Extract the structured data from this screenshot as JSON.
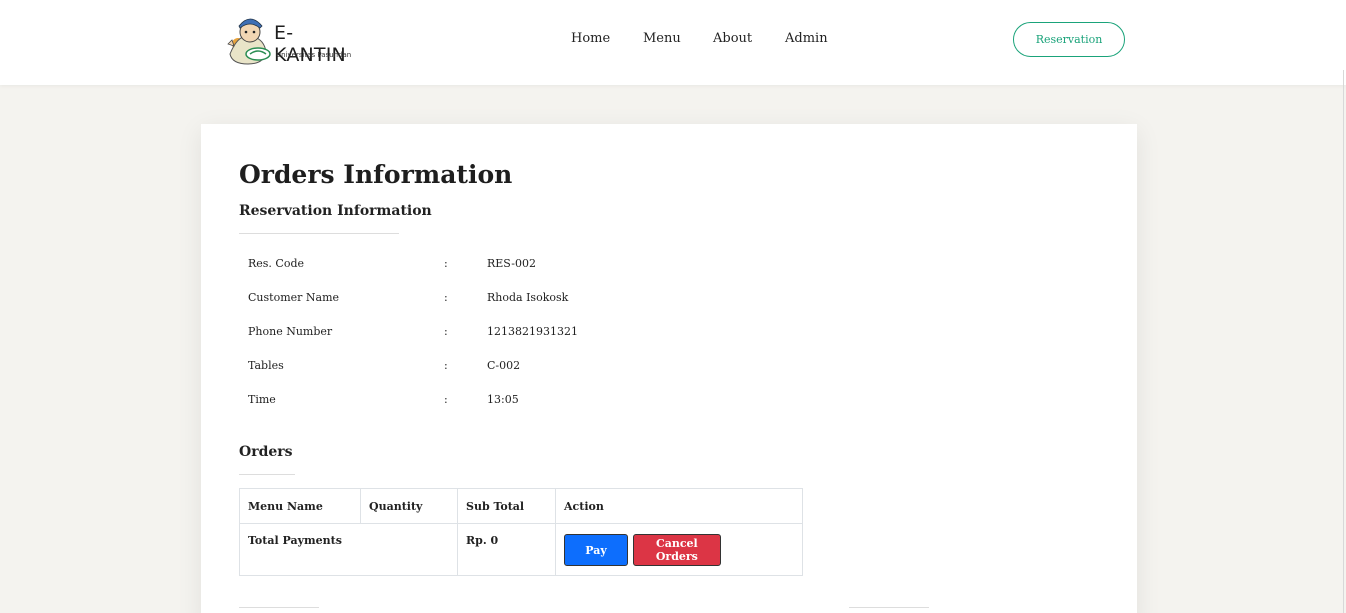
{
  "brand": {
    "name": "E-KANTIN",
    "subtitle": "Universitas Pasundan"
  },
  "nav": {
    "items": [
      "Home",
      "Menu",
      "About",
      "Admin"
    ],
    "reservation_button": "Reservation"
  },
  "page": {
    "title": "Orders Information",
    "reservation_section": "Reservation Information",
    "orders_section": "Orders"
  },
  "reservation": {
    "rows": [
      {
        "label": "Res. Code",
        "colon": ":",
        "value": "RES-002"
      },
      {
        "label": "Customer Name",
        "colon": ":",
        "value": "Rhoda Isokosk"
      },
      {
        "label": "Phone Number",
        "colon": ":",
        "value": "1213821931321"
      },
      {
        "label": "Tables",
        "colon": ":",
        "value": "C-002"
      },
      {
        "label": "Time",
        "colon": ":",
        "value": "13:05"
      }
    ]
  },
  "orders": {
    "headers": [
      "Menu Name",
      "Quantity",
      "Sub Total",
      "Action"
    ],
    "total_label": "Total Payments",
    "total_value": "Rp. 0",
    "pay_button": "Pay",
    "cancel_button": "Cancel Orders"
  },
  "colors": {
    "accent": "#1aa37a",
    "pay": "#0d6efd",
    "cancel": "#dc3545"
  },
  "icons": {
    "logo": "ekantin-mascot-logo"
  }
}
